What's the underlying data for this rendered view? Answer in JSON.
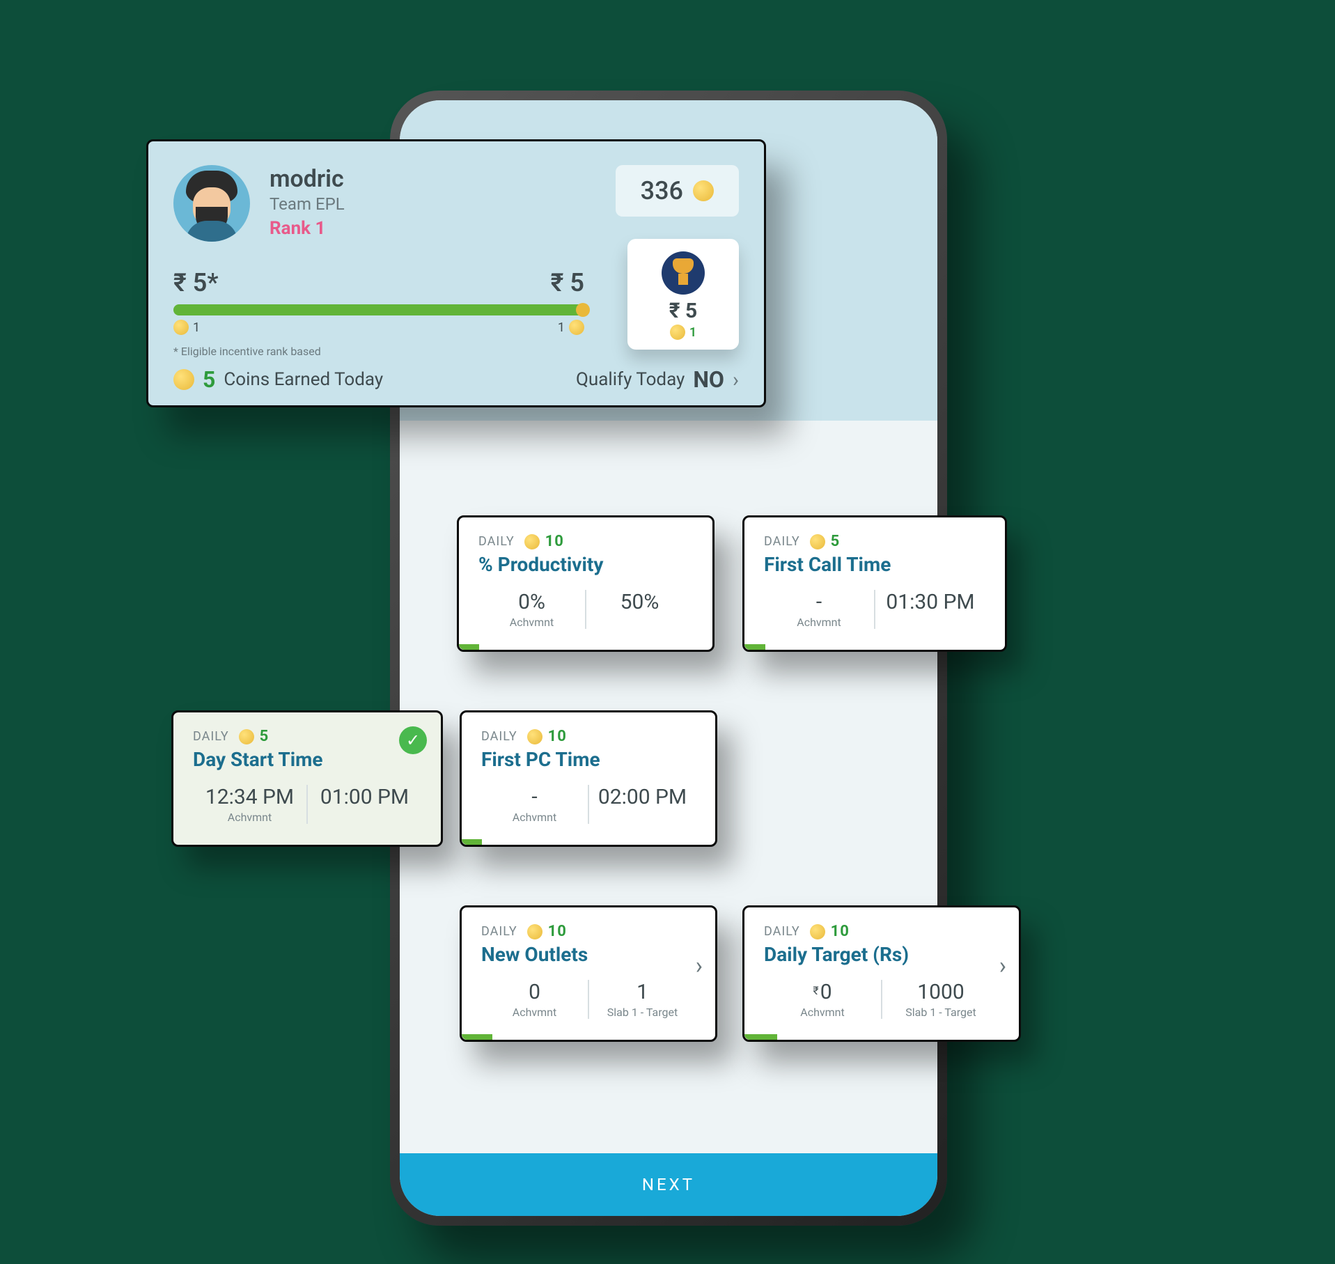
{
  "summary": {
    "name": "modric",
    "team": "Team EPL",
    "rank": "Rank 1",
    "coin_total": "336",
    "amount_left": "₹  5*",
    "amount_right": "₹  5",
    "bar_left": "1",
    "bar_right": "1",
    "eligible_note": "* Eligible incentive rank based",
    "coins_earned_num": "5",
    "coins_earned_label": "Coins Earned Today",
    "qualify_label": "Qualify Today",
    "qualify_value": "NO",
    "trophy_value": "₹  5",
    "trophy_coins": "1"
  },
  "kpi": {
    "daily_label": "DAILY",
    "productivity": {
      "pts": "10",
      "title": "% Productivity",
      "ach": "0%",
      "ach_lbl": "Achvmnt",
      "tgt": "50%",
      "prog_w": "8%"
    },
    "first_call": {
      "pts": "5",
      "title": "First Call Time",
      "ach": "-",
      "ach_lbl": "Achvmnt",
      "tgt": "01:30 PM",
      "prog_w": "8%"
    },
    "day_start": {
      "pts": "5",
      "title": "Day Start Time",
      "ach": "12:34 PM",
      "ach_lbl": "Achvmnt",
      "tgt": "01:00 PM"
    },
    "first_pc": {
      "pts": "10",
      "title": "First PC Time",
      "ach": "-",
      "ach_lbl": "Achvmnt",
      "tgt": "02:00 PM",
      "prog_w": "8%"
    },
    "new_outlets": {
      "pts": "10",
      "title": "New Outlets",
      "ach": "0",
      "ach_lbl": "Achvmnt",
      "tgt": "1",
      "tgt_lbl": "Slab 1 - Target",
      "prog_w": "12%"
    },
    "daily_target": {
      "pts": "10",
      "title": "Daily Target (Rs)",
      "ach": "0",
      "ach_pre": "₹",
      "ach_lbl": "Achvmnt",
      "tgt": "1000",
      "tgt_lbl": "Slab 1 - Target",
      "prog_w": "12%"
    }
  },
  "footer": {
    "next": "NEXT"
  }
}
